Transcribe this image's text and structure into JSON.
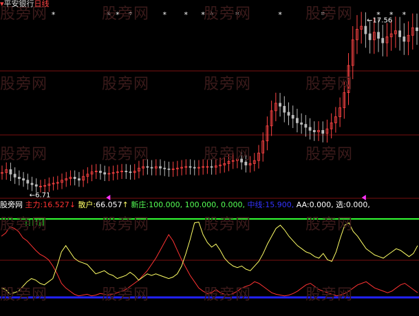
{
  "top_title": {
    "stock_name": "平安银行",
    "period": "日线"
  },
  "indicator_header": {
    "name": "股旁网",
    "items": [
      {
        "label": "主力:",
        "value": "16.527",
        "arrow": "↓",
        "color": "#ff3333"
      },
      {
        "label": "散户:",
        "value": "66.057",
        "arrow": "↑",
        "color": "#ffff66"
      },
      {
        "label": "新庄:",
        "value": "100.000, 100.000, 0.000,",
        "arrow": "",
        "color": "#55ff55"
      },
      {
        "label": "中线:",
        "value": "15.900,",
        "arrow": "",
        "color": "#3333ff"
      },
      {
        "label": "AA:",
        "value": "0.000,",
        "arrow": "",
        "color": "#ffffff"
      },
      {
        "label": "选:",
        "value": "0.000,",
        "arrow": "",
        "color": "#ffffff"
      }
    ]
  },
  "watermark": "股旁网",
  "colors": {
    "up": "#ff4444",
    "down": "#bbbbbb",
    "grid": "#7a1010",
    "main_line": "#ff3333",
    "retail_line": "#ffff66",
    "green_line": "#33ff33",
    "blue_line": "#2222ff",
    "marker": "#ff33ff"
  },
  "chart_data": [
    {
      "type": "candlestick",
      "title": "平安银行 日线",
      "ylim": [
        6.0,
        18.5
      ],
      "annotations": [
        {
          "text": "←6.71",
          "value": 6.71
        },
        {
          "text": "←17.56",
          "value": 17.56
        }
      ],
      "close": [
        7.7,
        7.9,
        7.6,
        7.4,
        7.3,
        7.2,
        7.0,
        6.9,
        6.8,
        6.8,
        6.85,
        6.95,
        7.0,
        7.05,
        7.2,
        7.3,
        7.4,
        7.3,
        7.2,
        7.45,
        7.6,
        7.75,
        7.8,
        7.7,
        7.6,
        7.65,
        7.7,
        7.75,
        7.8,
        7.75,
        7.7,
        7.8,
        8.0,
        8.1,
        8.05,
        8.0,
        8.1,
        8.0,
        7.95,
        7.9,
        7.95,
        8.0,
        8.05,
        8.1,
        8.05,
        8.0,
        8.05,
        8.1,
        8.1,
        8.05,
        8.15,
        8.2,
        8.3,
        8.45,
        8.5,
        8.6,
        8.4,
        8.2,
        8.3,
        8.5,
        9.0,
        9.8,
        10.8,
        11.8,
        12.3,
        12.1,
        11.7,
        11.5,
        11.3,
        11.0,
        10.9,
        10.7,
        10.5,
        10.4,
        10.5,
        10.3,
        10.6,
        11.0,
        11.4,
        12.0,
        13.0,
        14.8,
        16.5,
        17.2,
        17.4,
        16.9,
        16.5,
        17.0,
        16.6,
        16.3,
        16.7,
        16.9,
        17.1,
        16.7,
        16.4,
        16.8,
        17.3,
        17.1
      ],
      "marker_star_value": 18.0,
      "stars": [
        12,
        25,
        27,
        30,
        38,
        43,
        47,
        49,
        55,
        65,
        75,
        88,
        91,
        94,
        98
      ]
    },
    {
      "type": "line",
      "title": "主力 / 散户 / 新庄 / 中线",
      "ylim": [
        0,
        100
      ],
      "x": [
        0,
        1,
        2,
        3,
        4,
        5,
        6,
        7,
        8,
        9,
        10,
        11,
        12,
        13,
        14,
        15,
        16,
        17,
        18,
        19,
        20,
        21,
        22,
        23,
        24,
        25,
        26,
        27,
        28,
        29,
        30,
        31,
        32,
        33,
        34,
        35,
        36,
        37,
        38,
        39,
        40,
        41,
        42,
        43,
        44,
        45,
        46,
        47,
        48,
        49,
        50,
        51,
        52,
        53,
        54,
        55,
        56,
        57,
        58,
        59,
        60,
        61,
        62,
        63,
        64,
        65,
        66,
        67,
        68,
        69,
        70,
        71,
        72,
        73,
        74,
        75,
        76,
        77,
        78,
        79,
        80,
        81,
        82,
        83,
        84,
        85,
        86,
        87,
        88,
        89,
        90,
        91,
        92,
        93,
        94,
        95,
        96,
        97
      ],
      "series": [
        {
          "name": "主力",
          "values": [
            78,
            82,
            90,
            88,
            84,
            76,
            72,
            66,
            60,
            55,
            52,
            48,
            40,
            30,
            18,
            12,
            8,
            4,
            2,
            3,
            4,
            2,
            3,
            5,
            4,
            3,
            4,
            6,
            8,
            10,
            14,
            18,
            22,
            28,
            34,
            42,
            50,
            60,
            70,
            80,
            72,
            60,
            48,
            38,
            28,
            20,
            12,
            8,
            5,
            6,
            10,
            6,
            4,
            3,
            5,
            8,
            12,
            14,
            16,
            20,
            18,
            14,
            10,
            6,
            4,
            3,
            2,
            3,
            5,
            8,
            12,
            16,
            18,
            14,
            10,
            8,
            6,
            4,
            2,
            3,
            5,
            8,
            12,
            16,
            18,
            20,
            16,
            12,
            10,
            8,
            6,
            8,
            12,
            16,
            18,
            14,
            10,
            6
          ]
        },
        {
          "name": "散户",
          "values": [
            12,
            10,
            4,
            6,
            8,
            14,
            20,
            24,
            22,
            18,
            16,
            20,
            24,
            40,
            58,
            66,
            58,
            50,
            46,
            44,
            42,
            36,
            30,
            32,
            34,
            30,
            28,
            24,
            26,
            28,
            32,
            28,
            22,
            26,
            30,
            28,
            30,
            28,
            26,
            24,
            26,
            30,
            40,
            56,
            74,
            95,
            96,
            80,
            70,
            64,
            68,
            60,
            50,
            44,
            40,
            38,
            40,
            36,
            34,
            40,
            46,
            56,
            68,
            78,
            88,
            92,
            86,
            78,
            72,
            66,
            62,
            58,
            56,
            52,
            50,
            56,
            48,
            46,
            58,
            76,
            92,
            95,
            84,
            78,
            70,
            62,
            58,
            54,
            52,
            50,
            54,
            58,
            62,
            60,
            56,
            52,
            56,
            66
          ]
        },
        {
          "name": "新庄",
          "values": [
            100,
            100
          ]
        },
        {
          "name": "中线",
          "values": [
            0,
            0
          ]
        }
      ]
    }
  ]
}
